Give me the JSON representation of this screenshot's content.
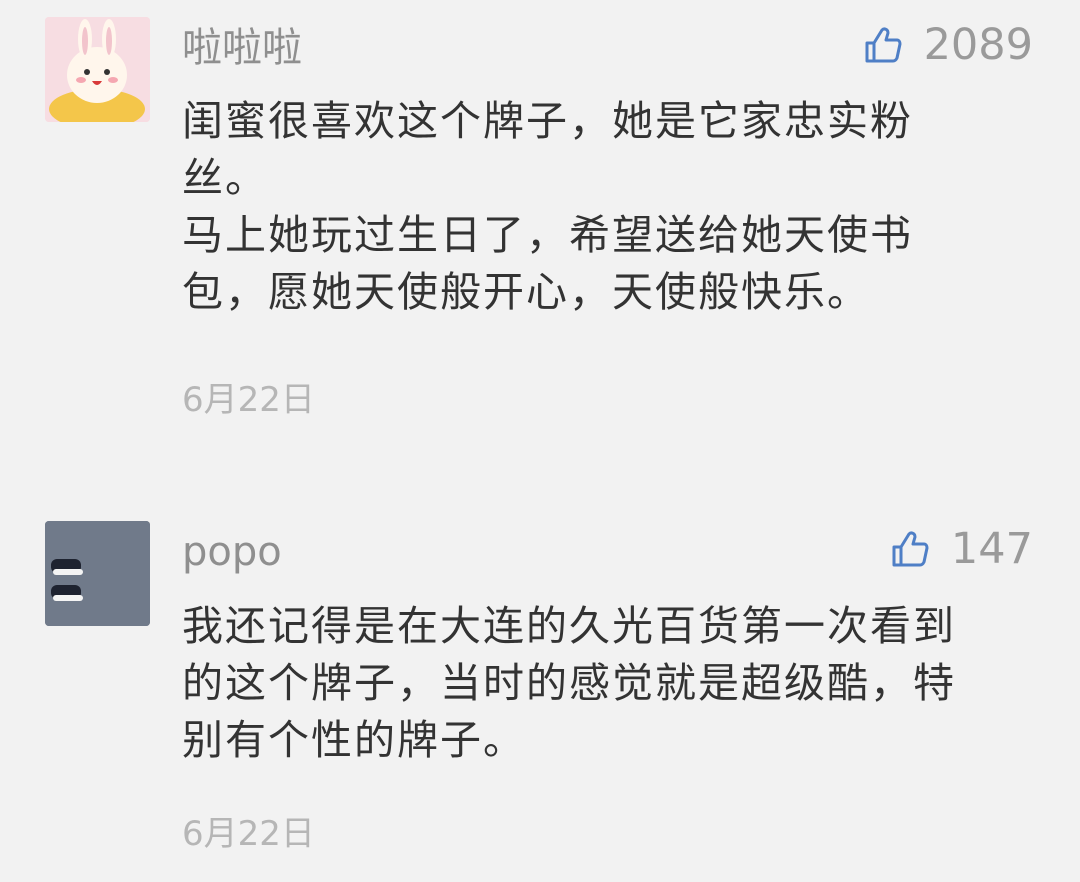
{
  "comments": [
    {
      "username": "啦啦啦",
      "like_count": "2089",
      "content_lines": [
        "闺蜜很喜欢这个牌子，她是它家忠实粉",
        "丝。",
        "马上她玩过生日了，希望送给她天使书",
        "包，愿她天使般开心，天使般快乐。"
      ],
      "date": "6月22日",
      "avatar_icon": "bunny-sticker-avatar",
      "colors": {
        "avatar_bg": "#f5dbe0"
      }
    },
    {
      "username": "popo",
      "like_count": "147",
      "content_lines": [
        "我还记得是在大连的久光百货第一次看到",
        "的这个牌子，当时的感觉就是超级酷，特",
        "别有个性的牌子。"
      ],
      "date": "6月22日",
      "avatar_icon": "sneakers-avatar",
      "colors": {
        "avatar_bg": "#6f7a88"
      }
    }
  ],
  "theme": {
    "like_icon": "thumbs-up-icon",
    "like_icon_color": "#4f7fc6",
    "background": "#f2f2f2"
  }
}
